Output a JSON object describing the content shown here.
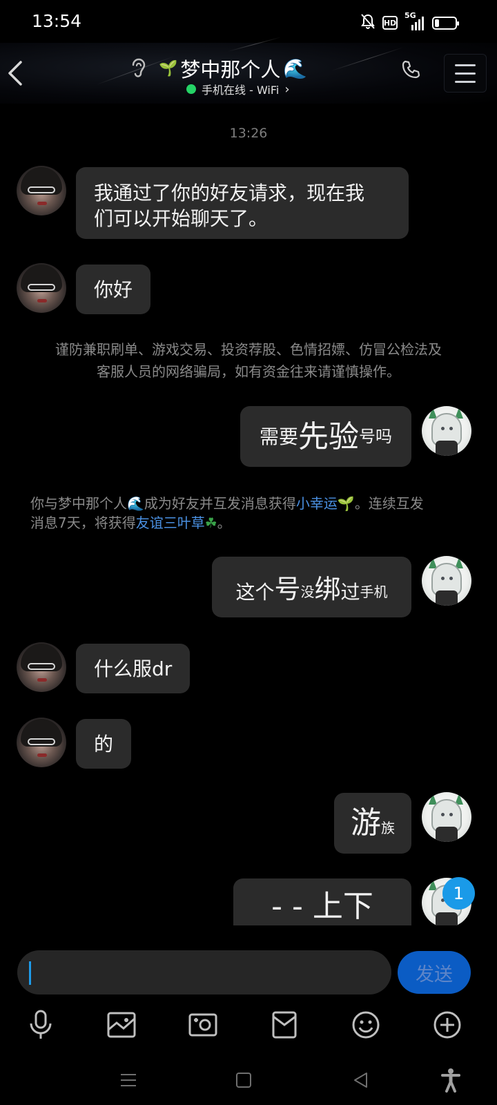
{
  "status_bar": {
    "time": "13:54",
    "hd_badge": "HD",
    "network": "5G",
    "battery_level": 0.2,
    "icons": [
      "mute-bell-icon",
      "hd-icon",
      "signal-icon",
      "battery-icon"
    ]
  },
  "header": {
    "contact_name": "梦中那个人",
    "name_prefix_emoji": "🌱",
    "name_suffix_emoji": "🌊",
    "status": "手机在线 - WiFi",
    "status_arrow": "›",
    "online_color": "#25d366",
    "icons": [
      "back-icon",
      "ear-icon",
      "phone-icon",
      "menu-icon"
    ]
  },
  "chat": {
    "timestamp": "13:26",
    "messages": [
      {
        "side": "left",
        "line1": "我通过了你的好友请求，现在我",
        "line2": "们可以开始聊天了。"
      },
      {
        "side": "left",
        "text": "你好"
      },
      {
        "side": "right",
        "parts": [
          "需要",
          "先验",
          "号吗"
        ]
      },
      {
        "side": "right",
        "parts": [
          "这个",
          "号",
          "没",
          "绑",
          "过",
          "手机"
        ]
      },
      {
        "side": "left",
        "text": "什么服dr"
      },
      {
        "side": "left",
        "text": "的"
      },
      {
        "side": "right",
        "parts": [
          "游",
          "族"
        ]
      },
      {
        "side": "right",
        "parts": [
          "- - 上下"
        ]
      }
    ],
    "safety_notice": {
      "line1": "谨防兼职刷单、游戏交易、投资荐股、色情招嫖、仿冒公检法及",
      "line2": "客服人员的网络骗局，如有资金往来请谨慎操作。"
    },
    "friend_notice": {
      "part1": "你与梦中那个人",
      "emoji1": "🌊",
      "part2": "成为好友并互发消息获得",
      "link1": "小幸运",
      "emoji2": "🌱",
      "part3": "。连续互发",
      "part4": "消息7天，将获得",
      "link2": "友谊三叶草",
      "emoji3": "☘",
      "part5": "。"
    },
    "unread_count": "1"
  },
  "input": {
    "value": "",
    "send_label": "发送",
    "accent_color": "#1e9be9"
  },
  "toolbar": {
    "icons": [
      "microphone-icon",
      "image-icon",
      "camera-icon",
      "red-packet-icon",
      "emoji-icon",
      "plus-icon"
    ]
  },
  "nav_bar": {
    "icons": [
      "nav-menu-icon",
      "nav-home-icon",
      "nav-back-icon",
      "accessibility-icon"
    ]
  }
}
